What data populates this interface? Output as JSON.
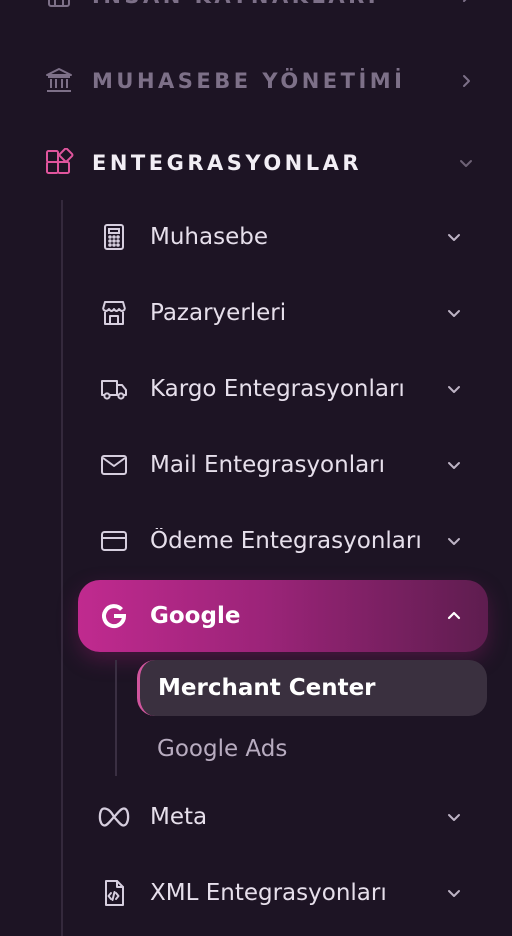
{
  "colors": {
    "background": "#1d1424",
    "accent": "#c02a8f",
    "accent_icon": "#e0559d",
    "muted_text": "#7d7088"
  },
  "sections": [
    {
      "label": "İNSAN KAYNAKLARI",
      "icon": "building-icon",
      "state": "collapsed"
    },
    {
      "label": "MUHASEBE YÖNETİMİ",
      "icon": "bank-icon",
      "state": "collapsed"
    },
    {
      "label": "ENTEGRASYONLAR",
      "icon": "grid-plus-icon",
      "state": "expanded"
    }
  ],
  "items": [
    {
      "label": "Muhasebe",
      "icon": "calculator-icon"
    },
    {
      "label": "Pazaryerleri",
      "icon": "store-icon"
    },
    {
      "label": "Kargo Entegrasyonları",
      "icon": "truck-icon"
    },
    {
      "label": "Mail Entegrasyonları",
      "icon": "mail-icon"
    },
    {
      "label": "Ödeme Entegrasyonları",
      "icon": "credit-card-icon"
    },
    {
      "label": "Google",
      "icon": "google-icon",
      "active": true
    },
    {
      "label": "Meta",
      "icon": "meta-icon"
    },
    {
      "label": "XML Entegrasyonları",
      "icon": "xml-file-icon"
    }
  ],
  "google_sub": [
    {
      "label": "Merchant Center",
      "selected": true
    },
    {
      "label": "Google Ads",
      "selected": false
    }
  ]
}
